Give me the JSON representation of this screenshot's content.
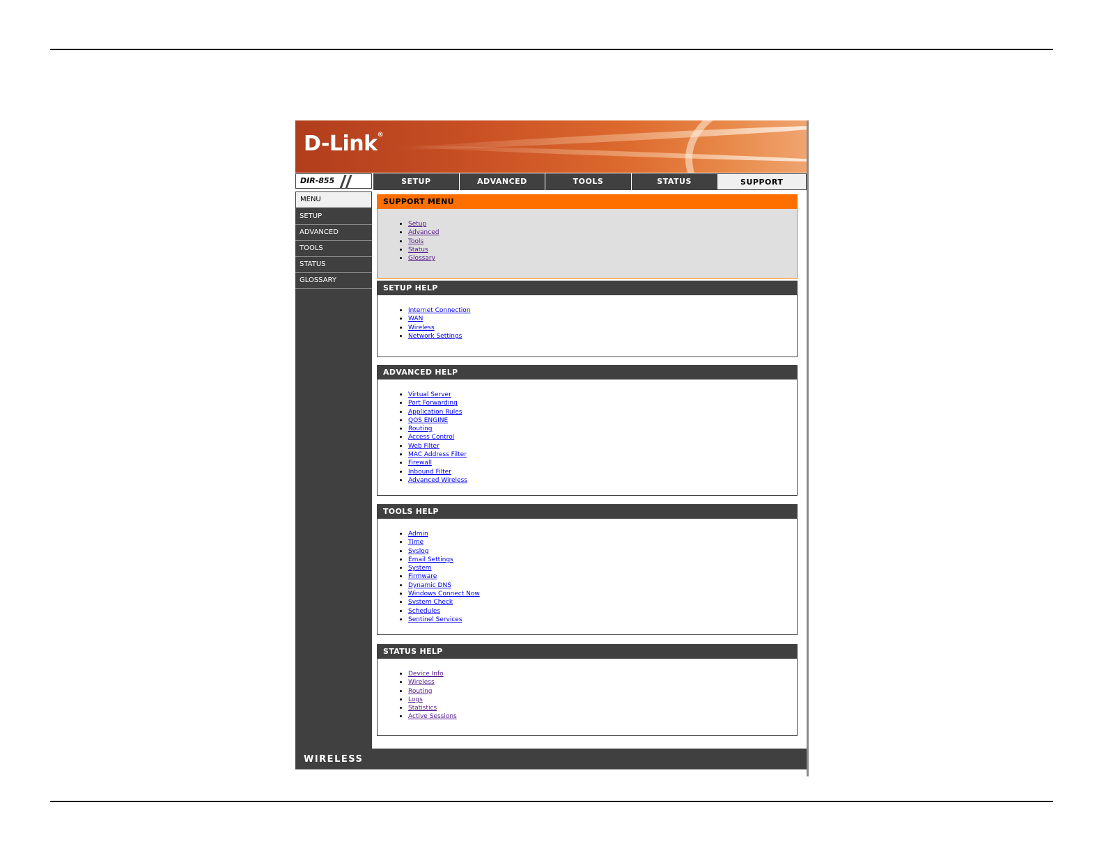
{
  "banner": {
    "logo": "D-Link",
    "logo_mark": "®"
  },
  "model": "DIR-855",
  "nav_tabs": [
    "SETUP",
    "ADVANCED",
    "TOOLS",
    "STATUS",
    "SUPPORT"
  ],
  "active_tab": "SUPPORT",
  "sidebar": [
    "MENU",
    "SETUP",
    "ADVANCED",
    "TOOLS",
    "STATUS",
    "GLOSSARY"
  ],
  "sections": [
    {
      "title": "SUPPORT MENU",
      "style": "orange",
      "visited": true,
      "links": [
        "Setup",
        "Advanced",
        "Tools",
        "Status",
        "Glossary"
      ]
    },
    {
      "title": "SETUP HELP",
      "style": "dark",
      "visited": false,
      "links": [
        "Internet Connection",
        "WAN",
        "Wireless",
        "Network Settings"
      ]
    },
    {
      "title": "ADVANCED HELP",
      "style": "dark",
      "visited": false,
      "links": [
        "Virtual Server",
        "Port Forwarding",
        "Application Rules",
        "QOS ENGINE",
        "Routing",
        "Access Control",
        "Web Filter",
        "MAC Address Filter",
        "Firewall",
        "Inbound Filter",
        "Advanced Wireless"
      ]
    },
    {
      "title": "TOOLS HELP",
      "style": "dark",
      "visited": false,
      "links": [
        "Admin",
        "Time",
        "Syslog",
        "Email Settings",
        "System",
        "Firmware",
        "Dynamic DNS",
        "Windows Connect Now",
        "System Check",
        "Schedules",
        "Sentinel Services"
      ]
    },
    {
      "title": "STATUS HELP",
      "style": "dark",
      "visited": true,
      "links": [
        "Device Info",
        "Wireless",
        "Routing",
        "Logs",
        "Statistics",
        "Active Sessions"
      ]
    }
  ],
  "footer": "WIRELESS",
  "colors": {
    "nav_dark": "#404040",
    "accent_orange": "#ff6f00",
    "link": "#0000ee",
    "link_visited": "#551a8b"
  }
}
